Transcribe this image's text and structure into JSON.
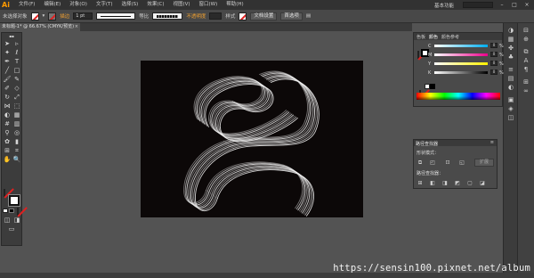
{
  "app": {
    "logo": "Ai"
  },
  "menubar": {
    "items": [
      "文件(F)",
      "编辑(E)",
      "对象(O)",
      "文字(T)",
      "选择(S)",
      "效果(C)",
      "视图(V)",
      "窗口(W)",
      "帮助(H)"
    ],
    "workspace": "基本功能"
  },
  "controlbar": {
    "selection_label": "未选择对象",
    "stroke_label": "描边",
    "stroke_value": "1 pt",
    "stroke_style": "等比",
    "opacity_label": "不透明度",
    "style_label": "样式",
    "doc_setup_button": "文档设置",
    "preferences_button": "首选项"
  },
  "document": {
    "tab_title": "未标题-1* @ 66.67% (CMYK/预览)",
    "close_glyph": "×",
    "artboard_color": "#0c0808"
  },
  "color_panel": {
    "tabs": [
      "色板",
      "颜色",
      "颜色参考"
    ],
    "sliders": [
      {
        "label": "C",
        "value": "0",
        "color_from": "#ffffff",
        "color_to": "#00aeef"
      },
      {
        "label": "M",
        "value": "0",
        "color_from": "#ffffff",
        "color_to": "#ec008c"
      },
      {
        "label": "Y",
        "value": "0",
        "color_from": "#ffffff",
        "color_to": "#fff200"
      },
      {
        "label": "K",
        "value": "0",
        "color_from": "#ffffff",
        "color_to": "#000000"
      }
    ],
    "percent_sign": "%"
  },
  "pathfinder_panel": {
    "title": "路径查找器",
    "shape_modes_label": "形状模式：",
    "pathfinders_label": "路径查找器：",
    "expand_button": "扩展"
  },
  "watermark": "https://sensin100.pixnet.net/album",
  "icons": {
    "toolbar": [
      "selection-tool-icon",
      "direct-selection-tool-icon",
      "magic-wand-tool-icon",
      "lasso-tool-icon",
      "pen-tool-icon",
      "type-tool-icon",
      "line-tool-icon",
      "rectangle-tool-icon",
      "paintbrush-tool-icon",
      "pencil-tool-icon",
      "blob-brush-tool-icon",
      "eraser-tool-icon",
      "rotate-tool-icon",
      "scale-tool-icon",
      "width-tool-icon",
      "free-transform-tool-icon",
      "shape-builder-tool-icon",
      "perspective-grid-tool-icon",
      "mesh-tool-icon",
      "gradient-tool-icon",
      "eyedropper-tool-icon",
      "blend-tool-icon",
      "symbol-sprayer-tool-icon",
      "column-graph-tool-icon",
      "artboard-tool-icon",
      "slice-tool-icon",
      "hand-tool-icon",
      "zoom-tool-icon"
    ]
  }
}
